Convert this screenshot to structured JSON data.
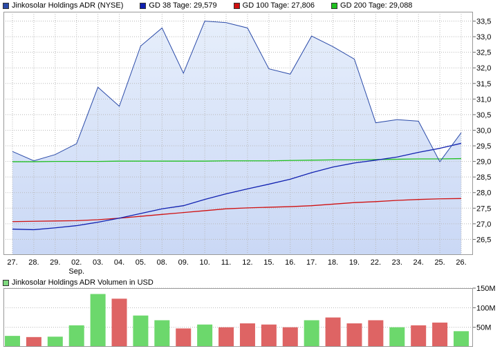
{
  "legend": {
    "price": {
      "label": "Jinkosolar Holdings ADR (NYSE)",
      "color": "#2a4aa8"
    },
    "gd38": {
      "label": "GD 38 Tage: 29,579",
      "color": "#1020b0"
    },
    "gd100": {
      "label": "GD 100 Tage: 27,806",
      "color": "#d01010"
    },
    "gd200": {
      "label": "GD 200 Tage: 29,088",
      "color": "#20c020"
    }
  },
  "volume_legend": {
    "label": "Jinkosolar Holdings ADR Volumen in USD",
    "color": "#7ed87e"
  },
  "chart_data": [
    {
      "type": "line",
      "categories": [
        "27.",
        "28.",
        "29.",
        "02.",
        "03.",
        "04.",
        "05.",
        "08.",
        "09.",
        "10.",
        "11.",
        "12.",
        "15.",
        "16.",
        "17.",
        "18.",
        "19.",
        "22.",
        "23.",
        "24.",
        "25.",
        "26."
      ],
      "month_label": {
        "text": "Sep.",
        "under_category": "02."
      },
      "ylim": [
        26.0,
        33.8
      ],
      "yticks": [
        "26,5",
        "27,0",
        "27,5",
        "28,0",
        "28,5",
        "29,0",
        "29,5",
        "30,0",
        "30,5",
        "31,0",
        "31,5",
        "32,0",
        "32,5",
        "33,0",
        "33,5"
      ],
      "ytick_values": [
        26.5,
        27.0,
        27.5,
        28.0,
        28.5,
        29.0,
        29.5,
        30.0,
        30.5,
        31.0,
        31.5,
        32.0,
        32.5,
        33.0,
        33.5
      ],
      "grid": true,
      "series": [
        {
          "name": "Jinkosolar Holdings ADR (NYSE)",
          "color": "#2a4aa8",
          "fill": true,
          "values": [
            29.32,
            29.02,
            29.22,
            29.57,
            31.38,
            30.77,
            32.7,
            33.28,
            31.83,
            33.5,
            33.45,
            33.28,
            31.97,
            31.8,
            33.02,
            32.68,
            32.28,
            30.24,
            30.34,
            30.29,
            28.99,
            29.92
          ]
        },
        {
          "name": "GD 38 Tage",
          "color": "#1020b0",
          "values": [
            26.83,
            26.81,
            26.87,
            26.94,
            27.05,
            27.18,
            27.33,
            27.48,
            27.58,
            27.78,
            27.96,
            28.12,
            28.27,
            28.43,
            28.64,
            28.82,
            28.95,
            29.04,
            29.14,
            29.29,
            29.42,
            29.58
          ]
        },
        {
          "name": "GD 100 Tage",
          "color": "#d01010",
          "values": [
            27.07,
            27.08,
            27.09,
            27.1,
            27.13,
            27.18,
            27.24,
            27.3,
            27.36,
            27.42,
            27.48,
            27.51,
            27.53,
            27.55,
            27.58,
            27.63,
            27.68,
            27.71,
            27.75,
            27.78,
            27.8,
            27.81
          ]
        },
        {
          "name": "GD 200 Tage",
          "color": "#20c020",
          "values": [
            28.99,
            28.99,
            29.0,
            29.0,
            29.0,
            29.01,
            29.01,
            29.01,
            29.01,
            29.01,
            29.02,
            29.02,
            29.02,
            29.03,
            29.04,
            29.05,
            29.05,
            29.06,
            29.07,
            29.08,
            29.08,
            29.09
          ]
        }
      ]
    },
    {
      "type": "bar",
      "title": "Jinkosolar Holdings ADR Volumen in USD",
      "categories": [
        "27.",
        "28.",
        "29.",
        "02.",
        "03.",
        "04.",
        "05.",
        "08.",
        "09.",
        "10.",
        "11.",
        "12.",
        "15.",
        "16.",
        "17.",
        "18.",
        "19.",
        "22.",
        "23.",
        "24.",
        "25.",
        "26."
      ],
      "ylim": [
        0,
        150
      ],
      "unit": "M",
      "yticks": [
        "50M",
        "100M",
        "150M"
      ],
      "ytick_values": [
        50,
        100,
        150
      ],
      "grid": true,
      "colors": {
        "up": "#6cd86c",
        "down": "#de6464"
      },
      "values": [
        28,
        25,
        26,
        55,
        135,
        123,
        80,
        68,
        47,
        57,
        50,
        60,
        57,
        50,
        68,
        75,
        60,
        68,
        50,
        55,
        62,
        40
      ],
      "direction": [
        "up",
        "down",
        "up",
        "up",
        "up",
        "down",
        "up",
        "up",
        "down",
        "up",
        "down",
        "down",
        "down",
        "down",
        "up",
        "down",
        "down",
        "down",
        "up",
        "down",
        "down",
        "up"
      ]
    }
  ]
}
